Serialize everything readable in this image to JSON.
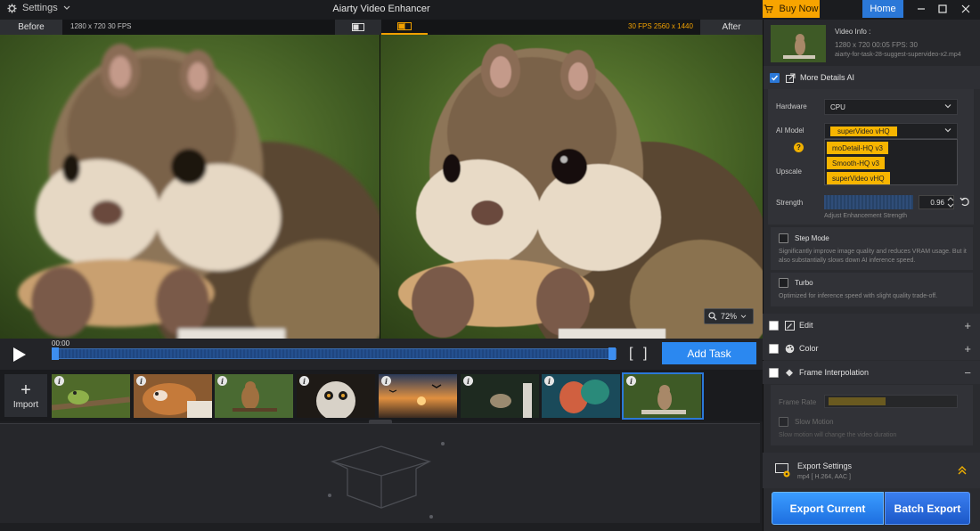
{
  "app": {
    "title": "Aiarty Video Enhancer",
    "settings_label": "Settings",
    "buy_now_label": "Buy Now",
    "home_label": "Home"
  },
  "compare": {
    "before_label": "Before",
    "after_label": "After",
    "before_resolution": "1280 x 720  30 FPS",
    "after_resolution": "30 FPS  2560 x 1440",
    "zoom_level": "72%"
  },
  "transport": {
    "time": "00:00",
    "add_task_label": "Add Task"
  },
  "thumbnails": {
    "import_label": "Import",
    "items": [
      {
        "name": "frog"
      },
      {
        "name": "dog"
      },
      {
        "name": "squirrel"
      },
      {
        "name": "owl"
      },
      {
        "name": "sunset-birds"
      },
      {
        "name": "deer"
      },
      {
        "name": "girl"
      },
      {
        "name": "chipmunk"
      }
    ],
    "selected_index": 7
  },
  "video_info": {
    "title": "Video Info :",
    "meta": "1280 x 720  00:05    FPS: 30",
    "file": "aiarty-for-task-28-suggest-supervideo-x2.mp4"
  },
  "more_details": {
    "label": "More Details AI",
    "hardware_label": "Hardware",
    "hardware_value": "CPU",
    "ai_model_label": "AI Model",
    "ai_model_value": "superVideo vHQ",
    "ai_model_options": [
      "moDetail-HQ  v3",
      "Smooth-HQ  v3",
      "superVideo vHQ"
    ],
    "upscale_label": "Upscale",
    "strength_label": "Strength",
    "strength_value": "0.96",
    "strength_desc": "Adjust Enhancement Strength",
    "step_mode_label": "Step Mode",
    "step_mode_desc": "Significantly improve image quality and reduces VRAM usage. But it also substantially slows down AI inference speed.",
    "turbo_label": "Turbo",
    "turbo_desc": "Optimized for inference speed with slight quality trade-off."
  },
  "edit": {
    "label": "Edit"
  },
  "color": {
    "label": "Color"
  },
  "frame_interp": {
    "label": "Frame Interpolation",
    "frame_rate_label": "Frame Rate",
    "slow_motion_label": "Slow Motion",
    "slow_motion_desc": "Slow motion will change the video duration"
  },
  "export": {
    "settings_label": "Export Settings",
    "settings_desc": "mp4 [ H.264, AAC ]",
    "export_current_label": "Export Current",
    "batch_export_label": "Batch Export"
  },
  "colors": {
    "accent_orange": "#f7a400",
    "accent_blue": "#2b78d8"
  }
}
